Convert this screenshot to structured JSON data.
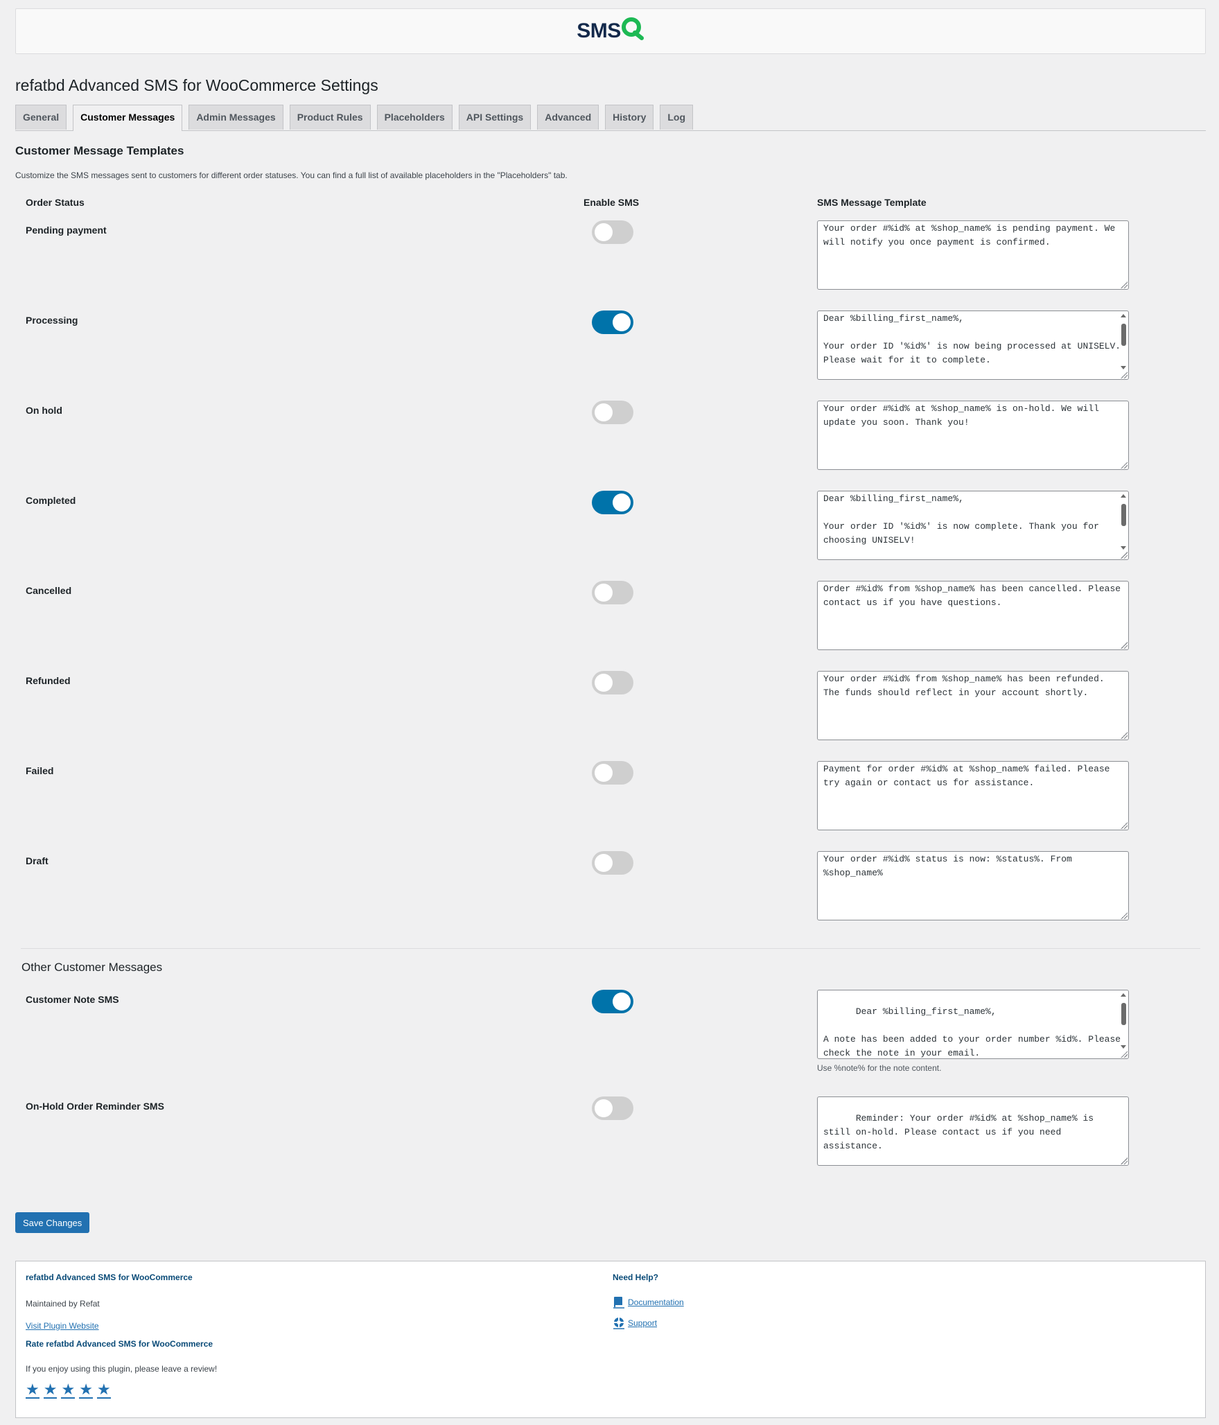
{
  "logo": {
    "text": "SMS",
    "mark_color": "#1db954"
  },
  "page_title": "refatbd Advanced SMS for WooCommerce Settings",
  "tabs": [
    {
      "label": "General",
      "active": false
    },
    {
      "label": "Customer Messages",
      "active": true
    },
    {
      "label": "Admin Messages",
      "active": false
    },
    {
      "label": "Product Rules",
      "active": false
    },
    {
      "label": "Placeholders",
      "active": false
    },
    {
      "label": "API Settings",
      "active": false
    },
    {
      "label": "Advanced",
      "active": false
    },
    {
      "label": "History",
      "active": false
    },
    {
      "label": "Log",
      "active": false
    }
  ],
  "section_title": "Customer Message Templates",
  "section_desc": "Customize the SMS messages sent to customers for different order statuses. You can find a full list of available placeholders in the \"Placeholders\" tab.",
  "headers": {
    "status": "Order Status",
    "enable": "Enable SMS",
    "template": "SMS Message Template"
  },
  "statuses": [
    {
      "label": "Pending payment",
      "enabled": false,
      "template": "Your order #%id% at %shop_name% is pending payment. We will notify you once payment is confirmed."
    },
    {
      "label": "Processing",
      "enabled": true,
      "template": "Dear %billing_first_name%,\n\nYour order ID '%id%' is now being processed at UNISELV. Please wait for it to complete."
    },
    {
      "label": "On hold",
      "enabled": false,
      "template": "Your order #%id% at %shop_name% is on-hold. We will update you soon. Thank you!"
    },
    {
      "label": "Completed",
      "enabled": true,
      "template": "Dear %billing_first_name%,\n\nYour order ID '%id%' is now complete. Thank you for choosing UNISELV!"
    },
    {
      "label": "Cancelled",
      "enabled": false,
      "template": "Order #%id% from %shop_name% has been cancelled. Please contact us if you have questions."
    },
    {
      "label": "Refunded",
      "enabled": false,
      "template": "Your order #%id% from %shop_name% has been refunded. The funds should reflect in your account shortly."
    },
    {
      "label": "Failed",
      "enabled": false,
      "template": "Payment for order #%id% at %shop_name% failed. Please try again or contact us for assistance."
    },
    {
      "label": "Draft",
      "enabled": false,
      "template": "Your order #%id% status is now: %status%. From %shop_name%"
    }
  ],
  "other_title": "Other Customer Messages",
  "customer_note": {
    "label": "Customer Note SMS",
    "enabled": true,
    "template": "Dear %billing_first_name%,\n\nA note has been added to your order number %id%. Please check the note in your email.",
    "hint": "Use %note% for the note content."
  },
  "onhold_reminder": {
    "label": "On-Hold Order Reminder SMS",
    "enabled": false,
    "template": "Reminder: Your order #%id% at %shop_name% is still on-hold. Please contact us if you need assistance."
  },
  "save_label": "Save Changes",
  "footer": {
    "plugin_name": "refatbd Advanced SMS for WooCommerce",
    "maintained": "Maintained by Refat",
    "visit_link": "Visit Plugin Website",
    "rate_title": "Rate refatbd Advanced SMS for WooCommerce",
    "rate_desc": "If you enjoy using this plugin, please leave a review!",
    "stars": "★",
    "help_title": "Need Help?",
    "doc_link": "Documentation",
    "support_link": "Support"
  },
  "colors": {
    "accent": "#2271b1",
    "toggle_on": "#0073aa",
    "toggle_off": "#cfcfcf"
  }
}
